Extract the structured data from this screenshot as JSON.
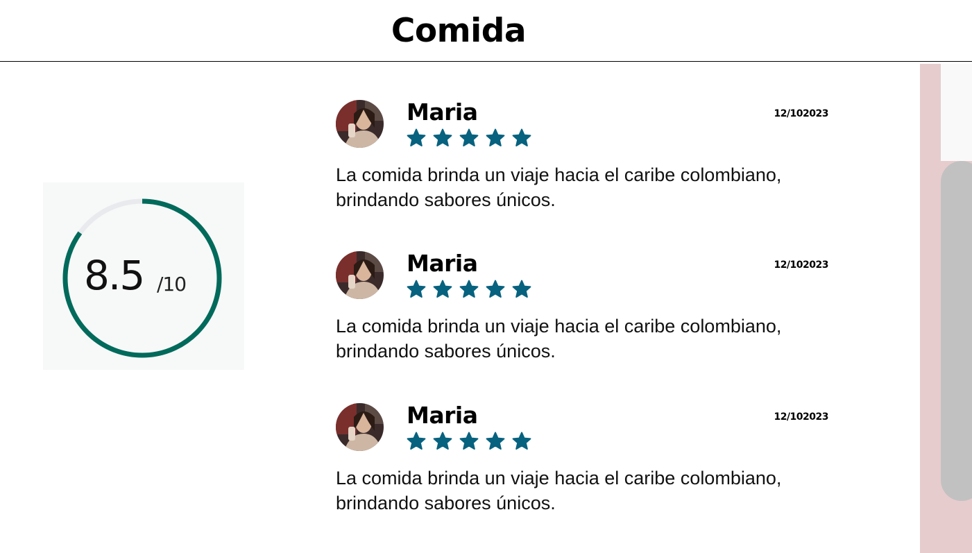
{
  "header": {
    "title": "Comida"
  },
  "score": {
    "value": "8.5",
    "max": "/10",
    "fraction": 0.85,
    "ring_color": "#006a5b",
    "track_color": "#e8eaed"
  },
  "reviews": [
    {
      "name": "Maria",
      "date": "12/102023",
      "rating": 5,
      "text": "La comida brinda un viaje hacia el caribe colombiano, brindando sabores únicos."
    },
    {
      "name": "Maria",
      "date": "12/102023",
      "rating": 5,
      "text": "La comida brinda un viaje hacia el caribe colombiano, brindando sabores únicos."
    },
    {
      "name": "Maria",
      "date": "12/102023",
      "rating": 5,
      "text": "La comida brinda un viaje hacia el caribe colombiano, brindando sabores únicos."
    }
  ],
  "colors": {
    "star": "#07627f",
    "scroll_track": "#e7cccd",
    "scroll_thumb": "#c1c1c1"
  },
  "icons": {
    "star": "star-icon",
    "avatar": "user-avatar"
  }
}
